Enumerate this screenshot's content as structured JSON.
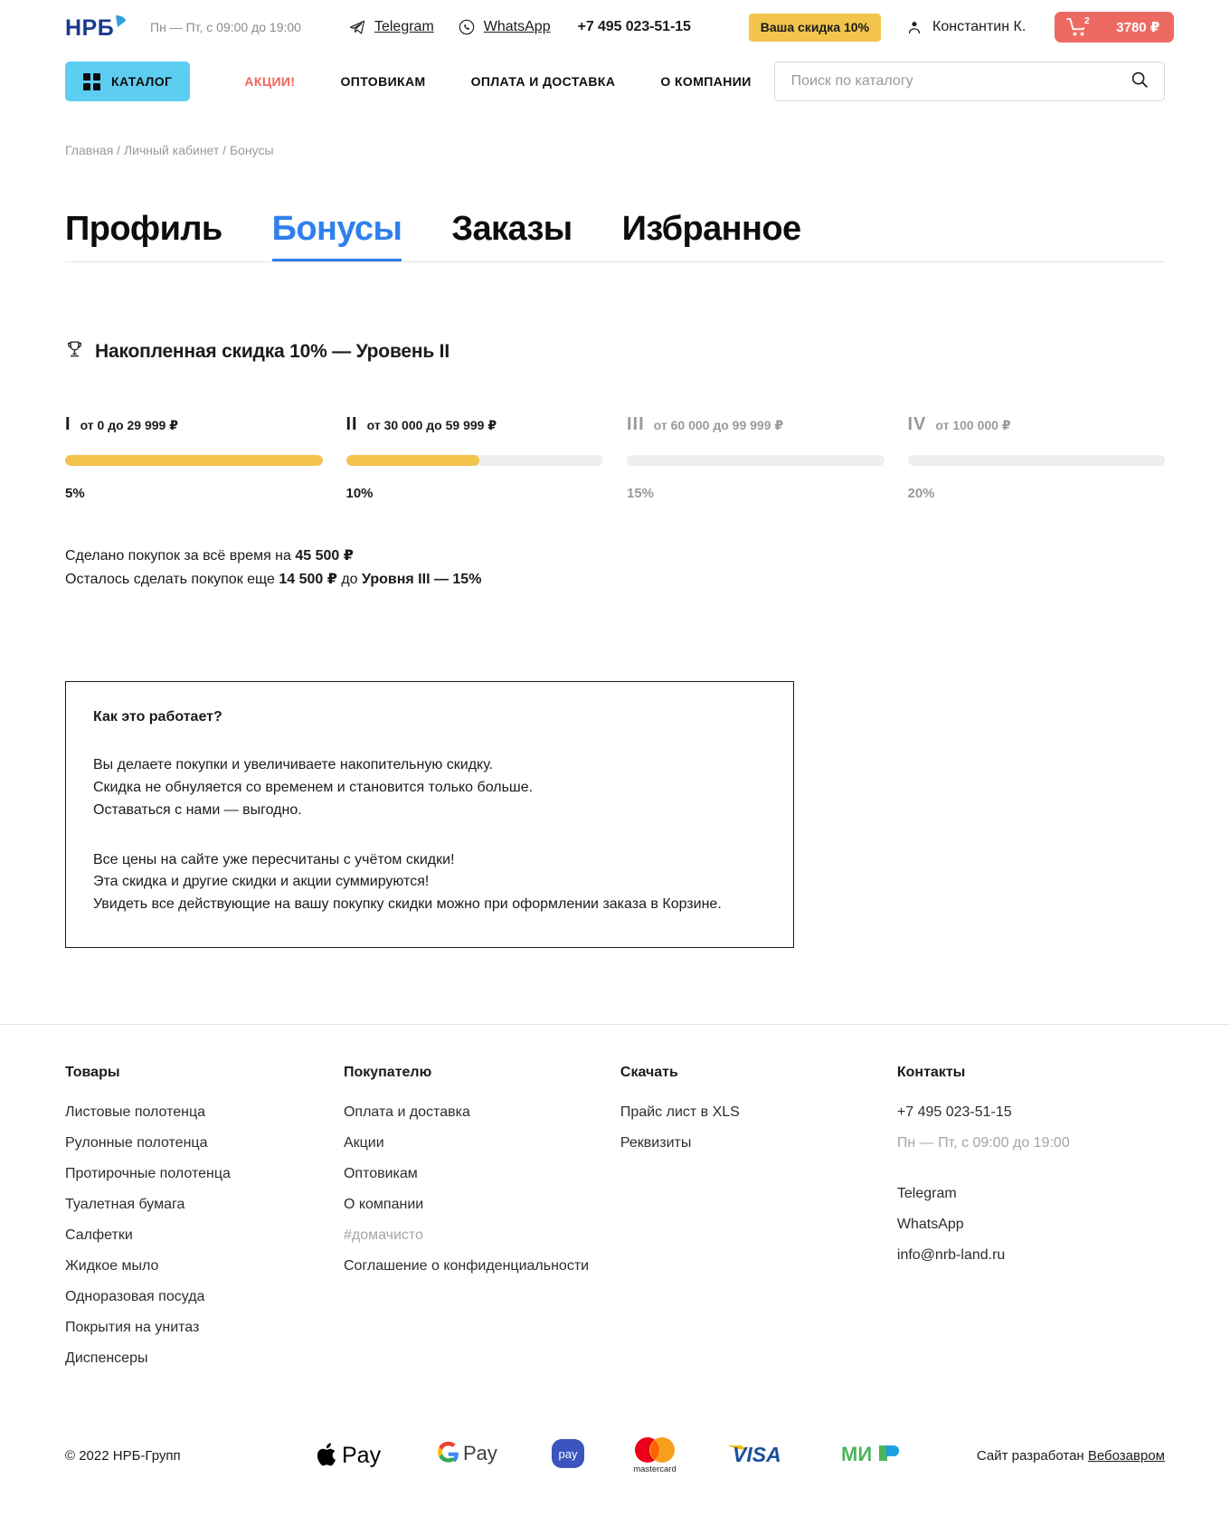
{
  "header": {
    "logo_text": "НРБ",
    "worktime": "Пн — Пт, с 09:00 до 19:00",
    "telegram": "Telegram",
    "whatsapp": "WhatsApp",
    "phone": "+7 495 023-51-15",
    "discount_badge": "Ваша скидка 10%",
    "user_name": "Константин К.",
    "cart_count": "2",
    "cart_sum": "3780 ₽"
  },
  "nav": {
    "catalog": "КАТАЛОГ",
    "links": [
      {
        "label": "АКЦИИ!"
      },
      {
        "label": "ОПТОВИКАМ"
      },
      {
        "label": "ОПЛАТА И ДОСТАВКА"
      },
      {
        "label": "О КОМПАНИИ"
      }
    ],
    "search_placeholder": "Поиск по каталогу",
    "search_value": ""
  },
  "breadcrumb": "Главная / Личный кабинет / Бонусы",
  "tabs": [
    {
      "label": "Профиль",
      "active": false
    },
    {
      "label": "Бонусы",
      "active": true
    },
    {
      "label": "Заказы",
      "active": false
    },
    {
      "label": "Избранное",
      "active": false
    }
  ],
  "bonus": {
    "title": "Накопленная скидка 10% — Уровень II",
    "trophy_icon": "trophy-icon",
    "levels": [
      {
        "roman": "I",
        "range": "от 0 до 29 999 ₽",
        "percent": "5%",
        "fill": 100,
        "state": "complete"
      },
      {
        "roman": "II",
        "range": "от 30 000 до 59 999 ₽",
        "percent": "10%",
        "fill": 52,
        "state": "current"
      },
      {
        "roman": "III",
        "range": "от 60 000 до 99 999 ₽",
        "percent": "15%",
        "fill": 0,
        "state": "locked"
      },
      {
        "roman": "IV",
        "range": "от 100 000 ₽",
        "percent": "20%",
        "fill": 0,
        "state": "locked"
      }
    ],
    "summary_line1_prefix": "Сделано покупок за всё время на ",
    "summary_line1_value": "45 500 ₽",
    "summary_line2_prefix": "Осталось сделать покупок еще ",
    "summary_line2_value": "14 500 ₽",
    "summary_line2_mid": " до ",
    "summary_line2_level": "Уровня III",
    "summary_line2_suffix": " — 15%"
  },
  "infobox": {
    "title": "Как это работает?",
    "paragraph1_line1": "Вы делаете покупки и увеличиваете накопительную скидку.",
    "paragraph1_line2": "Скидка не обнуляется со временем и становится только больше.",
    "paragraph1_line3": "Оставаться с нами — выгодно.",
    "paragraph2_line1": "Все цены на сайте уже пересчитаны с учётом скидки!",
    "paragraph2_line2": "Эта скидка и другие скидки и акции суммируются!",
    "paragraph2_line3": "Увидеть все действующие на вашу покупку скидки можно при оформлении заказа в Корзине."
  },
  "footer": {
    "col1": {
      "title": "Товары",
      "items": [
        {
          "label": "Листовые полотенца"
        },
        {
          "label": "Рулонные полотенца"
        },
        {
          "label": "Протирочные полотенца"
        },
        {
          "label": "Туалетная бумага"
        },
        {
          "label": "Салфетки"
        },
        {
          "label": "Жидкое мыло"
        },
        {
          "label": "Одноразовая посуда"
        },
        {
          "label": "Покрытия на унитаз"
        },
        {
          "label": "Диспенсеры"
        }
      ]
    },
    "col2": {
      "title": "Покупателю",
      "items": [
        {
          "label": "Оплата и доставка",
          "muted": false
        },
        {
          "label": "Акции",
          "muted": false
        },
        {
          "label": "Оптовикам",
          "muted": false
        },
        {
          "label": "О компании",
          "muted": false
        },
        {
          "label": "#домачисто",
          "muted": true
        },
        {
          "label": "Соглашение о конфиденциальности",
          "muted": false
        }
      ]
    },
    "col3": {
      "title": "Скачать",
      "items": [
        {
          "label": "Прайс лист в XLS"
        },
        {
          "label": "Реквизиты"
        }
      ]
    },
    "col4": {
      "title": "Контакты",
      "phone": "+7 495 023-51-15",
      "worktime": "Пн — Пт, с 09:00 до 19:00",
      "telegram": "Telegram",
      "whatsapp": "WhatsApp",
      "email": "info@nrb-land.ru"
    }
  },
  "bottom": {
    "copyright": "© 2022 НРБ-Групп",
    "payments": [
      "apple-pay-icon",
      "google-pay-icon",
      "samsung-pay-icon",
      "mastercard-icon",
      "visa-icon",
      "mir-icon"
    ],
    "developed_prefix": "Сайт разработан ",
    "developed_link": "Вебозавром"
  },
  "colors": {
    "accent_blue": "#2f80ed",
    "catalog_cyan": "#5ecdf2",
    "promo_red": "#f2645c",
    "cart_red": "#ed6a63",
    "gold": "#f3c44c",
    "track": "#efefef",
    "muted": "#9a9a9a"
  }
}
